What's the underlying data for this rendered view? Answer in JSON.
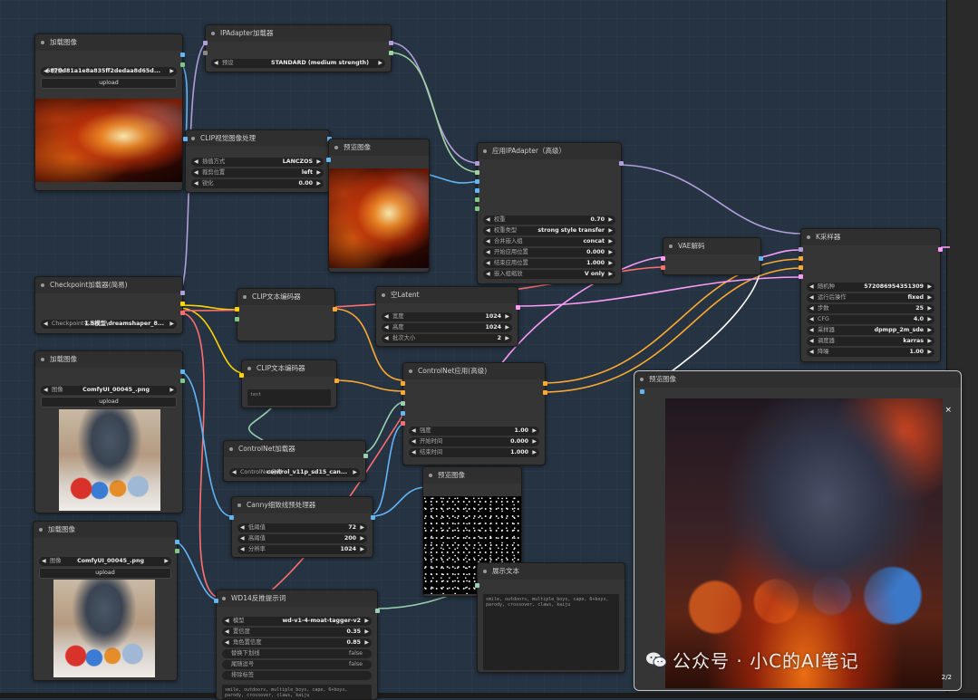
{
  "nodes": {
    "load1": {
      "title": "加载图像",
      "image_label": "图像",
      "image_value": "6870d81a1e8a835ff2dedaa8d65d...",
      "upload": "upload"
    },
    "ipadapter_loader": {
      "title": "IPAdapter加载器",
      "preset_label": "预设",
      "preset_value": "STANDARD (medium strength)"
    },
    "clip_vision": {
      "title": "CLIP视觉图像处理",
      "interp_label": "插值方式",
      "interp_value": "LANCZOS",
      "crop_label": "裁剪位置",
      "crop_value": "left",
      "sharp_label": "锐化",
      "sharp_value": "0.00"
    },
    "preview1": {
      "title": "预览图像"
    },
    "apply_ip": {
      "title": "应用IPAdapter（高级）",
      "weight_label": "权重",
      "weight_value": "0.70",
      "wtype_label": "权重类型",
      "wtype_value": "strong style transfer",
      "combine_label": "合并嵌入组",
      "combine_value": "concat",
      "start_label": "开始应用位置",
      "start_value": "0.000",
      "end_label": "结束应用位置",
      "end_value": "1.000",
      "scale_label": "嵌入组缩放",
      "scale_value": "V only"
    },
    "vae": {
      "title": "VAE解码"
    },
    "ksampler": {
      "title": "K采样器",
      "seed_label": "随机种",
      "seed_value": "572086954351309",
      "after_label": "运行后操作",
      "after_value": "fixed",
      "steps_label": "步数",
      "steps_value": "25",
      "cfg_label": "CFG",
      "cfg_value": "4.0",
      "sampler_label": "采样器",
      "sampler_value": "dpmpp_2m_sde",
      "sched_label": "调度器",
      "sched_value": "karras",
      "denoise_label": "降噪",
      "denoise_value": "1.00"
    },
    "checkpoint": {
      "title": "Checkpoint加载器(简易)",
      "ckpt_label": "Checkpoint名称",
      "ckpt_value": "1.5模型\\dreamshaper_8..."
    },
    "clip_text1": {
      "title": "CLIP文本编码器"
    },
    "clip_text2": {
      "title": "CLIP文本编码器",
      "placeholder": "text"
    },
    "empty_latent": {
      "title": "空Latent",
      "w_label": "宽度",
      "w_value": "1024",
      "h_label": "高度",
      "h_value": "1024",
      "b_label": "批次大小",
      "b_value": "2"
    },
    "load2": {
      "title": "加载图像",
      "image_label": "图像",
      "image_value": "ComfyUI_00045_.png",
      "upload": "upload"
    },
    "controlnet_apply": {
      "title": "ControlNet应用(高级)",
      "strength_label": "强度",
      "strength_value": "1.00",
      "start_label": "开始时间",
      "start_value": "0.000",
      "end_label": "结束时间",
      "end_value": "1.000"
    },
    "controlnet_loader": {
      "title": "ControlNet加载器",
      "name_label": "ControlNet名称",
      "name_value": "control_v11p_sd15_can..."
    },
    "canny": {
      "title": "Canny细致线预处理器",
      "low_label": "低阈值",
      "low_value": "72",
      "high_label": "高阈值",
      "high_value": "200",
      "res_label": "分辨率",
      "res_value": "1024"
    },
    "preview2": {
      "title": "预览图像"
    },
    "load3": {
      "title": "加载图像",
      "image_label": "图像",
      "image_value": "ComfyUI_00045_.png",
      "upload": "upload"
    },
    "show_text": {
      "title": "展示文本",
      "text": "smile, outdoors, multiple_boys, cape, 6+boys, parody, crossover, claws, kaiju"
    },
    "wd14": {
      "title": "WD14反推提示词",
      "model_label": "模型",
      "model_value": "wd-v1-4-moat-tagger-v2",
      "thr_label": "置信度",
      "thr_value": "0.35",
      "cthr_label": "角色置信度",
      "cthr_value": "0.85",
      "t1_label": "替换下划线",
      "t1_value": "false",
      "t2_label": "尾随逗号",
      "t2_value": "false",
      "t3_label": "排除标签",
      "text": "smile, outdoors, multiple_boys, cape, 6+boys, parody, crossover, claws, kaiju"
    },
    "preview3": {
      "title": "预览图像",
      "close": "×",
      "counter": "2/2"
    }
  },
  "watermark": "公众号 · 小C的AI笔记",
  "colors": {
    "canvas": "#253342",
    "node_bg": "#353535",
    "wire_model": "#b39ddb",
    "wire_clip": "#ffd500",
    "wire_cond": "#ffa931",
    "wire_vae": "#ff6e6e",
    "wire_image": "#64b5f6",
    "wire_latent": "#ff9cf9",
    "wire_control": "#00d78d"
  }
}
